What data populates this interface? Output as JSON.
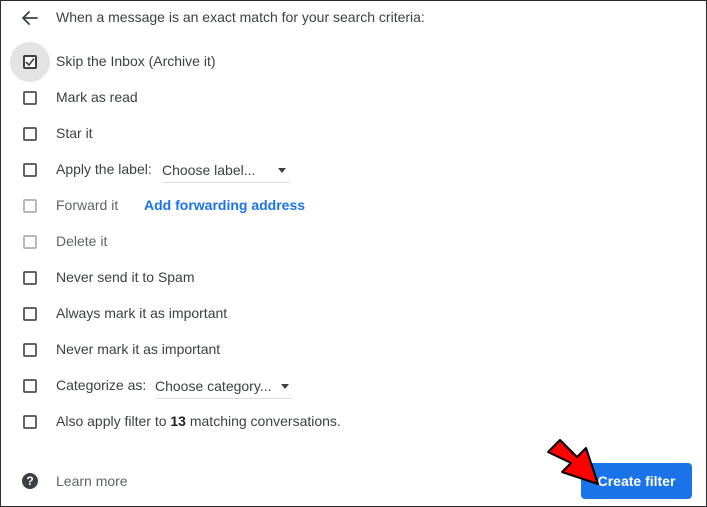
{
  "header": {
    "text": "When a message is an exact match for your search criteria:"
  },
  "options": {
    "skip_inbox": {
      "label": "Skip the Inbox (Archive it)",
      "checked": true
    },
    "mark_read": {
      "label": "Mark as read",
      "checked": false
    },
    "star": {
      "label": "Star it",
      "checked": false
    },
    "apply_label": {
      "label": "Apply the label:",
      "select_value": "Choose label...",
      "checked": false
    },
    "forward": {
      "label": "Forward it",
      "link": "Add forwarding address",
      "checked": false,
      "disabled": true
    },
    "delete": {
      "label": "Delete it",
      "checked": false,
      "disabled": true
    },
    "never_spam": {
      "label": "Never send it to Spam",
      "checked": false
    },
    "always_important": {
      "label": "Always mark it as important",
      "checked": false
    },
    "never_important": {
      "label": "Never mark it as important",
      "checked": false
    },
    "categorize": {
      "label": "Categorize as:",
      "select_value": "Choose category...",
      "checked": false
    },
    "also_apply": {
      "prefix": "Also apply filter to ",
      "count": "13",
      "suffix": " matching conversations.",
      "checked": false
    }
  },
  "footer": {
    "help_icon": "?",
    "learn_more": "Learn more",
    "create_button": "Create filter"
  },
  "colors": {
    "accent": "#1a73e8",
    "annotation_arrow": "#ff0000"
  },
  "icons": [
    "back-arrow-icon",
    "checkmark-icon",
    "dropdown-caret-icon",
    "help-icon",
    "red-pointer-arrow"
  ]
}
